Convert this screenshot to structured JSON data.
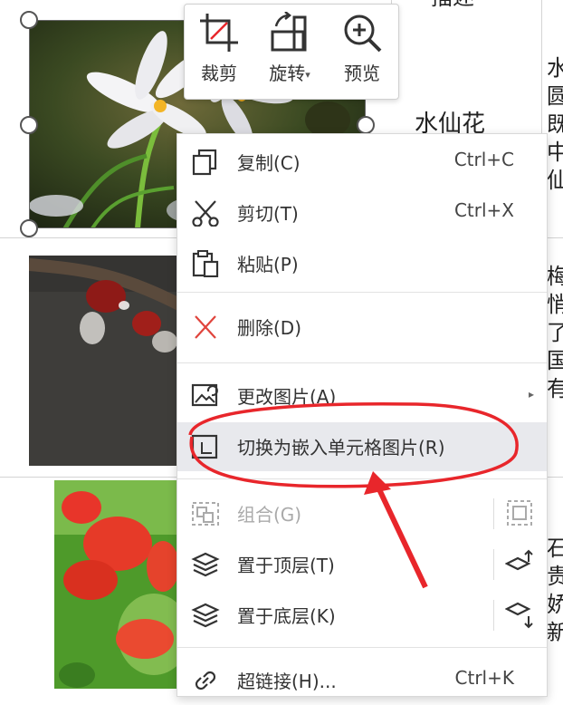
{
  "sheet": {
    "cells": {
      "narcissus_name": "水仙花",
      "header_partial": "描述"
    },
    "right_column": {
      "row1": "水圆既中仙",
      "row2": "梅。悄。了国有",
      "row3": "石贵娇新"
    }
  },
  "toolbar": {
    "crop_label": "裁剪",
    "rotate_label": "旋转",
    "preview_label": "预览"
  },
  "context_menu": {
    "copy": {
      "label": "复制(C)",
      "shortcut": "Ctrl+C"
    },
    "cut": {
      "label": "剪切(T)",
      "shortcut": "Ctrl+X"
    },
    "paste": {
      "label": "粘贴(P)"
    },
    "delete": {
      "label": "删除(D)"
    },
    "change_picture": {
      "label": "更改图片(A)"
    },
    "embed_in_cell": {
      "label": "切换为嵌入单元格图片(R)"
    },
    "group": {
      "label": "组合(G)"
    },
    "bring_front": {
      "label": "置于顶层(T)"
    },
    "send_back": {
      "label": "置于底层(K)"
    },
    "hyperlink": {
      "label": "超链接(H)...",
      "shortcut": "Ctrl+K"
    }
  },
  "icons": {
    "crop": "crop-icon",
    "rotate": "rotate-icon",
    "preview": "zoom-in-icon",
    "copy": "copy-icon",
    "cut": "scissors-icon",
    "paste": "clipboard-icon",
    "delete": "x-icon",
    "change_picture": "image-swap-icon",
    "embed": "image-embed-icon",
    "group": "group-icon",
    "layer_top": "layers-up-icon",
    "layer_bottom": "layers-down-icon",
    "hyperlink": "link-icon"
  },
  "colors": {
    "annotation": "#e8262b",
    "menu_highlight": "#e8e9ed",
    "delete_icon": "#e0443c"
  }
}
